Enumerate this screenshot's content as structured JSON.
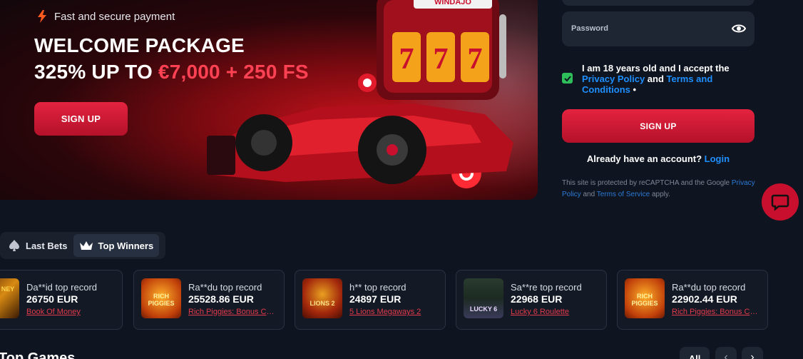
{
  "hero": {
    "payment_text": "Fast and secure payment",
    "title_line1": "WELCOME PACKAGE",
    "title_line2_prefix": "325% UP TO ",
    "title_line2_accent": "€7,000 + 250 FS",
    "signup_label": "SIGN UP",
    "slot_brand": "WINDAJO"
  },
  "form": {
    "password_label": "Password",
    "accept_text_1": "I am 18 years old and I accept the ",
    "privacy_link": "Privacy Policy",
    "and_text": " and ",
    "terms_link": "Terms and Conditions",
    "required_mark": " •",
    "signup_label": "SIGN UP",
    "have_account": "Already have an account?",
    "login_link": "Login",
    "recaptcha_1": "This site is protected by reCAPTCHA and the Google ",
    "recaptcha_privacy": "Privacy Policy",
    "recaptcha_and": " and ",
    "recaptcha_terms": "Terms of Service",
    "recaptcha_end": " apply."
  },
  "tabs": [
    {
      "label": "Last Bets",
      "icon": "spade-icon"
    },
    {
      "label": "Top Winners",
      "icon": "crown-icon"
    }
  ],
  "winners": [
    {
      "name": "Da**id top record",
      "amount": "26750 EUR",
      "game": "Book Of Money",
      "thumb_label": "K OF NEY"
    },
    {
      "name": "Ra**du top record",
      "amount": "25528.86 EUR",
      "game": "Rich Piggies: Bonus Combo",
      "thumb_label": "RICH PIGGIES"
    },
    {
      "name": "h** top record",
      "amount": "24897 EUR",
      "game": "5 Lions Megaways 2",
      "thumb_label": "LIONS 2"
    },
    {
      "name": "Sa**re top record",
      "amount": "22968 EUR",
      "game": "Lucky 6 Roulette",
      "thumb_label": "LUCKY 6"
    },
    {
      "name": "Ra**du top record",
      "amount": "22902.44 EUR",
      "game": "Rich Piggies: Bonus Combo",
      "thumb_label": "RICH PIGGIES"
    }
  ],
  "bottom": {
    "section_title": "Top Games",
    "all_label": "All",
    "prev_arrow": "‹",
    "next_arrow": "›"
  },
  "colors": {
    "accent_red": "#e4233f",
    "link_blue": "#1e8fff",
    "background": "#0f1520",
    "check_green": "#2fbf5a"
  }
}
